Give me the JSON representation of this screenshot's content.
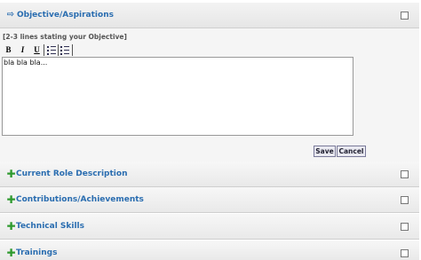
{
  "objective": {
    "title": "Objective/Aspirations",
    "hint": "[2-3 lines stating your Objective]",
    "toolbar": {
      "bold": "B",
      "italic": "I",
      "underline": "U"
    },
    "editor_text": "bla bla bla...",
    "save_label": "Save",
    "cancel_label": "Cancel"
  },
  "sections": [
    {
      "title": "Current Role Description"
    },
    {
      "title": "Contributions/Achievements"
    },
    {
      "title": "Technical Skills"
    },
    {
      "title": "Trainings"
    }
  ],
  "colors": {
    "link": "#2a6db0",
    "plus": "#2f9a2f"
  }
}
